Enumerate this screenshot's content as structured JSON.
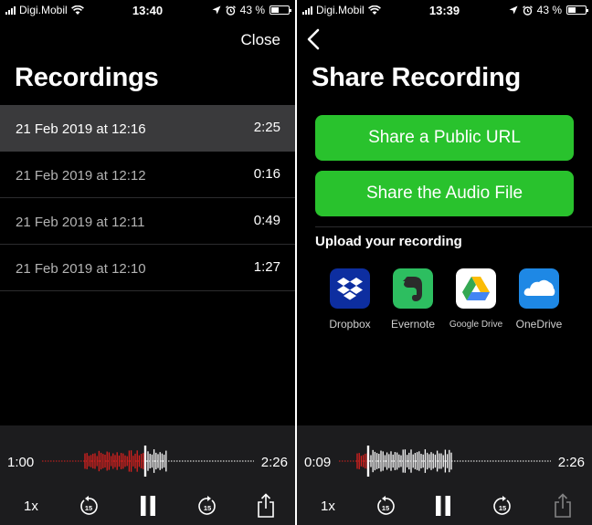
{
  "screen_left": {
    "status": {
      "carrier": "Digi.Mobil",
      "time": "13:40",
      "battery": "43 %",
      "battery_level": 0.43
    },
    "close_label": "Close",
    "title": "Recordings",
    "recordings": [
      {
        "date": "21 Feb 2019 at 12:16",
        "duration": "2:25",
        "selected": true
      },
      {
        "date": "21 Feb 2019 at 12:12",
        "duration": "0:16",
        "selected": false
      },
      {
        "date": "21 Feb 2019 at 12:11",
        "duration": "0:49",
        "selected": false
      },
      {
        "date": "21 Feb 2019 at 12:10",
        "duration": "1:27",
        "selected": false
      }
    ],
    "player": {
      "current": "1:00",
      "total": "2:26",
      "speed": "1x",
      "progress": 0.4,
      "played_color": "#d9211e",
      "unplayed_color": "#ffffff"
    }
  },
  "screen_right": {
    "status": {
      "carrier": "Digi.Mobil",
      "time": "13:39",
      "battery": "43 %",
      "battery_level": 0.43
    },
    "title": "Share Recording",
    "buttons": {
      "public_url": "Share a Public URL",
      "audio_file": "Share the Audio File"
    },
    "upload_label": "Upload your recording",
    "services": [
      {
        "name": "Dropbox",
        "icon": "dropbox-icon",
        "color": "#0d2ea0"
      },
      {
        "name": "Evernote",
        "icon": "evernote-icon",
        "color": "#2dbe60"
      },
      {
        "name": "Google Drive",
        "icon": "google-drive-icon",
        "color": "#ffffff"
      },
      {
        "name": "OneDrive",
        "icon": "onedrive-icon",
        "color": "#1e88e5"
      }
    ],
    "player": {
      "current": "0:09",
      "total": "2:26",
      "speed": "1x",
      "progress": 0.05,
      "played_color": "#d9211e",
      "unplayed_color": "#ffffff"
    }
  },
  "colors": {
    "accent_green": "#29c22d",
    "background": "#000000",
    "selected_row": "#3a3a3c"
  },
  "icons": {
    "skip_back": "rewind-15-icon",
    "skip_forward": "forward-15-icon",
    "pause": "pause-icon",
    "share": "share-icon",
    "back": "chevron-left-icon"
  }
}
